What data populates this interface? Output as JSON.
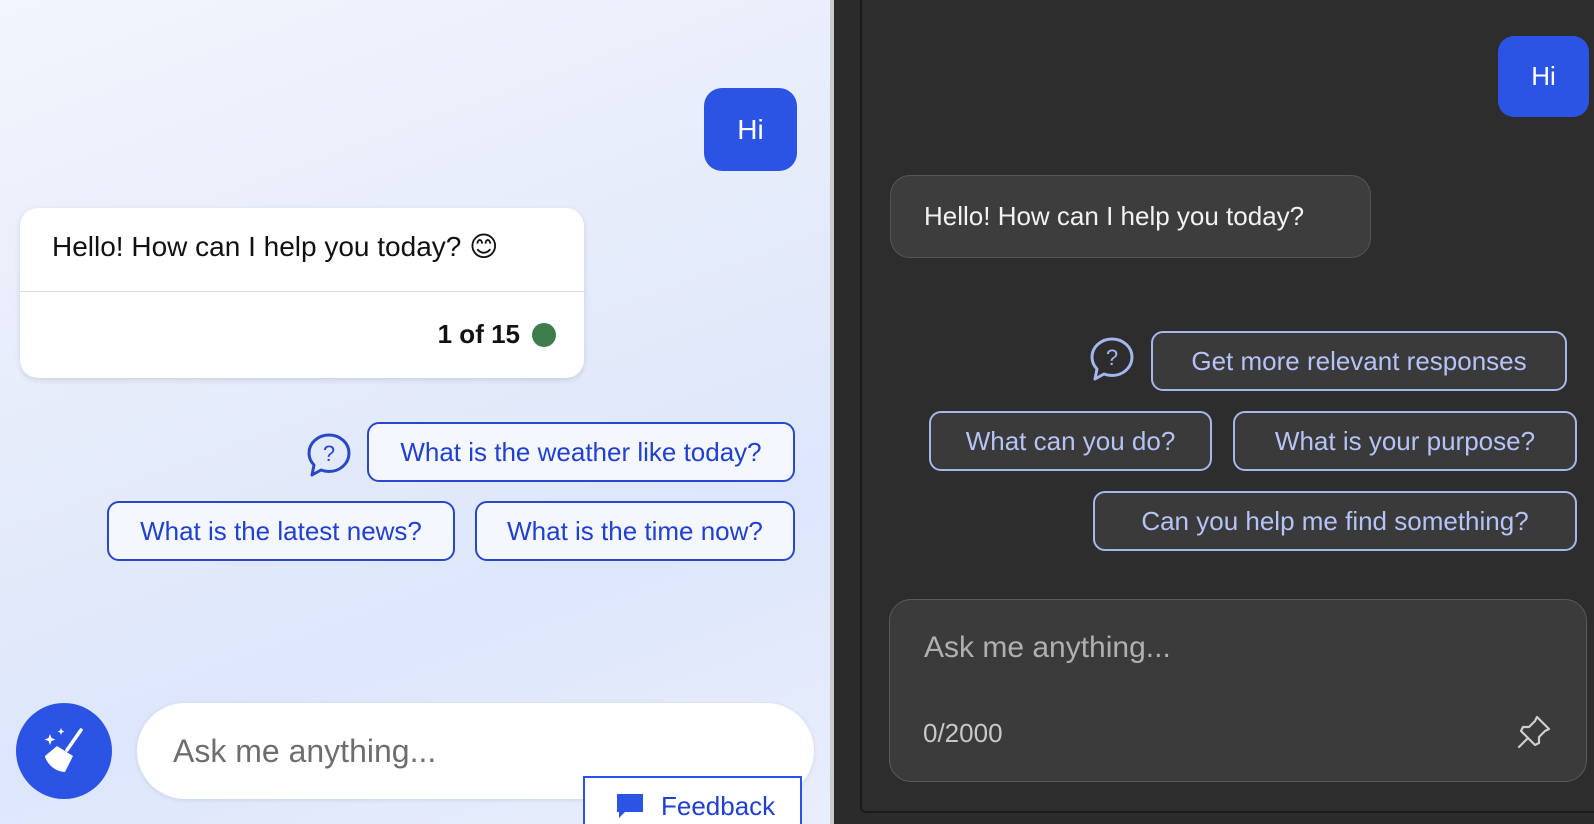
{
  "light": {
    "user_message": "Hi",
    "bot_message": "Hello! How can I help you today? 😊",
    "response_counter": "1 of 15",
    "status_color": "#3f7c4c",
    "suggestions": [
      "What is the weather like today?",
      "What is the latest news?",
      "What is the time now?"
    ],
    "input_placeholder": "Ask me anything...",
    "feedback_label": "Feedback",
    "accent": "#2b54e4",
    "icons": [
      "help-bubble-icon",
      "broom-sparkle-icon",
      "feedback-comment-icon"
    ]
  },
  "dark": {
    "user_message": "Hi",
    "bot_message": "Hello! How can I help you today?",
    "suggestions": [
      "Get more relevant responses",
      "What can you do?",
      "What is your purpose?",
      "Can you help me find something?"
    ],
    "input_placeholder": "Ask me anything...",
    "char_counter": "0/2000",
    "icons": [
      "help-bubble-icon",
      "pin-icon"
    ]
  }
}
